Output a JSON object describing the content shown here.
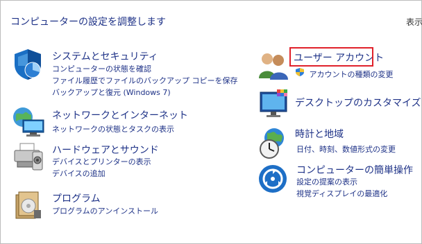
{
  "page": {
    "title": "コンピューターの設定を調整します",
    "view_by": "表示"
  },
  "left": [
    {
      "name": "system-security",
      "title": "システムとセキュリティ",
      "links": [
        "コンピューターの状態を確認",
        "ファイル履歴でファイルのバックアップ コピーを保存",
        "バックアップと復元 (Windows 7)"
      ]
    },
    {
      "name": "network-internet",
      "title": "ネットワークとインターネット",
      "links": [
        "ネットワークの状態とタスクの表示"
      ]
    },
    {
      "name": "hardware-sound",
      "title": "ハードウェアとサウンド",
      "links": [
        "デバイスとプリンターの表示",
        "デバイスの追加"
      ]
    },
    {
      "name": "programs",
      "title": "プログラム",
      "links": [
        "プログラムのアンインストール"
      ]
    }
  ],
  "right": [
    {
      "name": "user-accounts",
      "title": "ユーザー アカウント",
      "links": [
        "アカウントの種類の変更"
      ]
    },
    {
      "name": "desktop-customization",
      "title": "デスクトップのカスタマイズ",
      "links": []
    },
    {
      "name": "clock-region",
      "title": "時計と地域",
      "links": [
        "日付、時刻、数値形式の変更"
      ]
    },
    {
      "name": "ease-of-access",
      "title": "コンピューターの簡単操作",
      "links": [
        "設定の提案の表示",
        "視覚ディスプレイの最適化"
      ]
    }
  ],
  "colors": {
    "link": "#1e3287",
    "highlight_border": "#e0202a"
  },
  "icons": [
    "shield-icon",
    "network-icon",
    "printer-icon",
    "programs-icon",
    "users-icon",
    "uac-shield-icon",
    "desktop-icon",
    "clock-globe-icon",
    "ease-of-access-icon"
  ]
}
